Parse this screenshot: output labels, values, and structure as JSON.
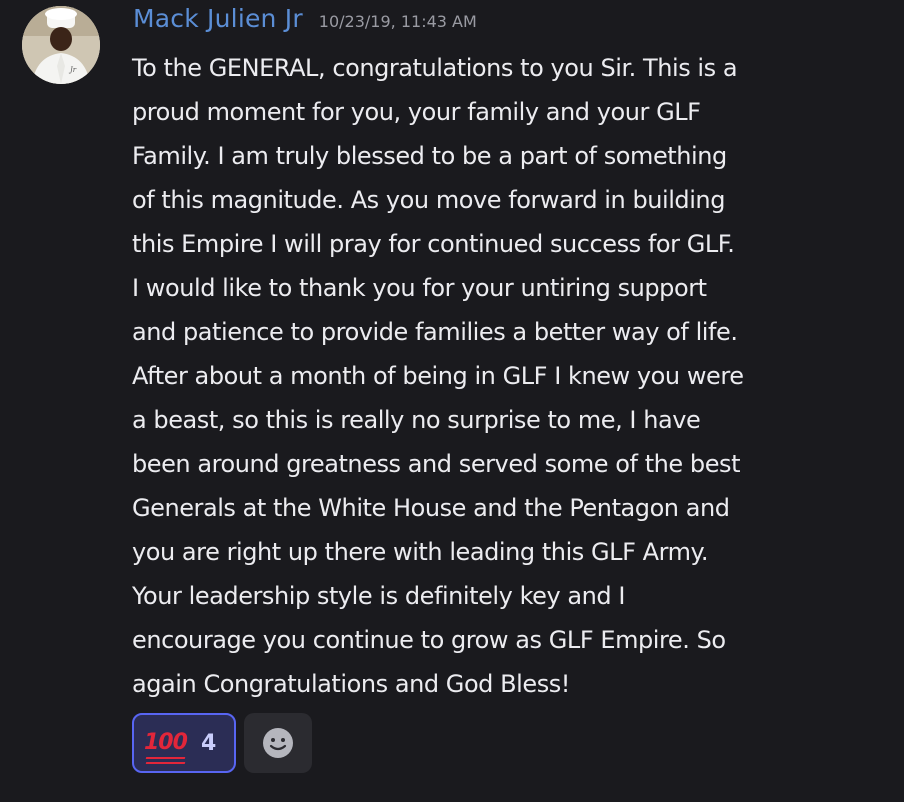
{
  "message": {
    "author": "Mack Julien Jr",
    "timestamp": "10/23/19, 11:43 AM",
    "avatar_icon": "user-avatar-chef",
    "author_color": "#5b8ed6",
    "lines": [
      "To the GENERAL, congratulations to you Sir. This is a",
      "proud moment for you, your family and your GLF",
      "Family. I am truly blessed to be a part of something",
      "of this magnitude. As you move forward in building",
      "this Empire I will pray for continued success for GLF.",
      "I would like to thank you for your untiring support",
      "and patience to provide families a better way of life.",
      "After about a month of being in GLF I knew you were",
      "a beast, so this is really no surprise to me, I have",
      "been around greatness and served some of the best",
      "Generals at the White House and the Pentagon and",
      "you are right up there with leading this GLF Army.",
      "Your leadership style is definitely key and I",
      "encourage you continue to grow as GLF Empire. So",
      "again Congratulations and God Bless!"
    ]
  },
  "reactions": [
    {
      "emoji": "100",
      "icon": "hundred-points-emoji",
      "count": "4",
      "accent": "#5865f2"
    }
  ],
  "add_reaction": {
    "icon": "add-reaction-smiley-icon"
  }
}
